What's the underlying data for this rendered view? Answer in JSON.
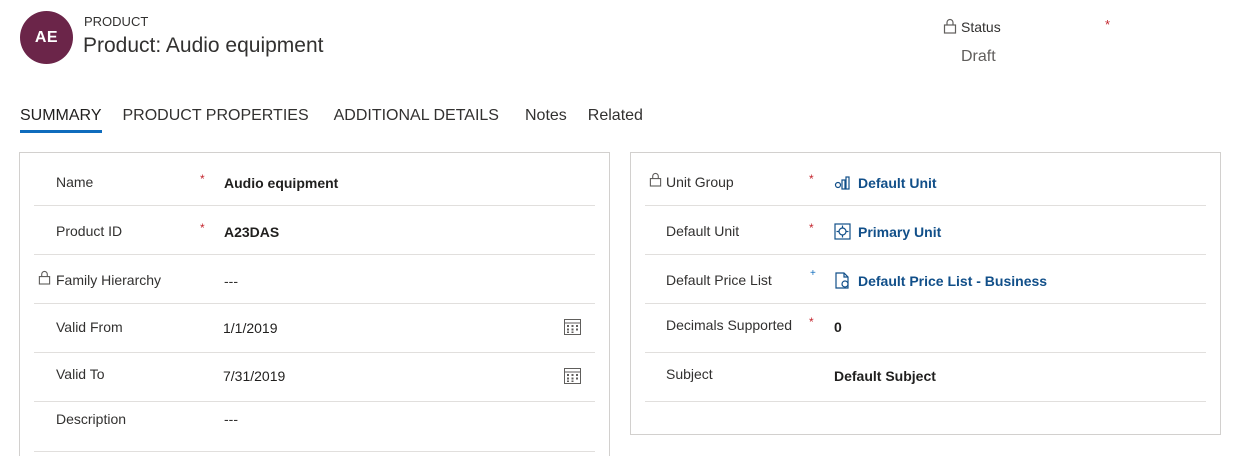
{
  "header": {
    "avatar_initials": "AE",
    "entity_type": "PRODUCT",
    "title": "Product: Audio equipment",
    "status": {
      "label": "Status",
      "required_marker": "*",
      "value": "Draft"
    }
  },
  "tabs": [
    {
      "label": "SUMMARY",
      "active": true
    },
    {
      "label": "PRODUCT PROPERTIES"
    },
    {
      "label": "ADDITIONAL DETAILS"
    },
    {
      "label": "Notes"
    },
    {
      "label": "Related"
    }
  ],
  "left_panel": {
    "fields": [
      {
        "label": "Name",
        "required": "*",
        "value": "Audio equipment"
      },
      {
        "label": "Product ID",
        "required": "*",
        "value": "A23DAS"
      },
      {
        "label": "Family Hierarchy",
        "value": "---",
        "locked": true
      },
      {
        "label": "Valid From",
        "value": "1/1/2019",
        "icon": "calendar-icon"
      },
      {
        "label": "Valid To",
        "value": "7/31/2019",
        "icon": "calendar-icon"
      },
      {
        "label": "Description",
        "value": "---"
      }
    ]
  },
  "right_panel": {
    "fields": [
      {
        "label": "Unit Group",
        "required": "*",
        "value": "Default Unit",
        "locked": true,
        "icon": "unit-group-icon"
      },
      {
        "label": "Default Unit",
        "required": "*",
        "value": "Primary Unit",
        "icon": "unit-icon"
      },
      {
        "label": "Default Price List",
        "recommended": "+",
        "value": "Default Price List - Business",
        "icon": "price-list-icon"
      },
      {
        "label": "Decimals Supported",
        "required": "*",
        "value": "0"
      },
      {
        "label": "Subject",
        "value": "Default Subject"
      }
    ]
  },
  "colors": {
    "avatar": "#6b2549",
    "accent": "#0f6cbd",
    "required": "#c4262e",
    "link": "#114f89"
  }
}
